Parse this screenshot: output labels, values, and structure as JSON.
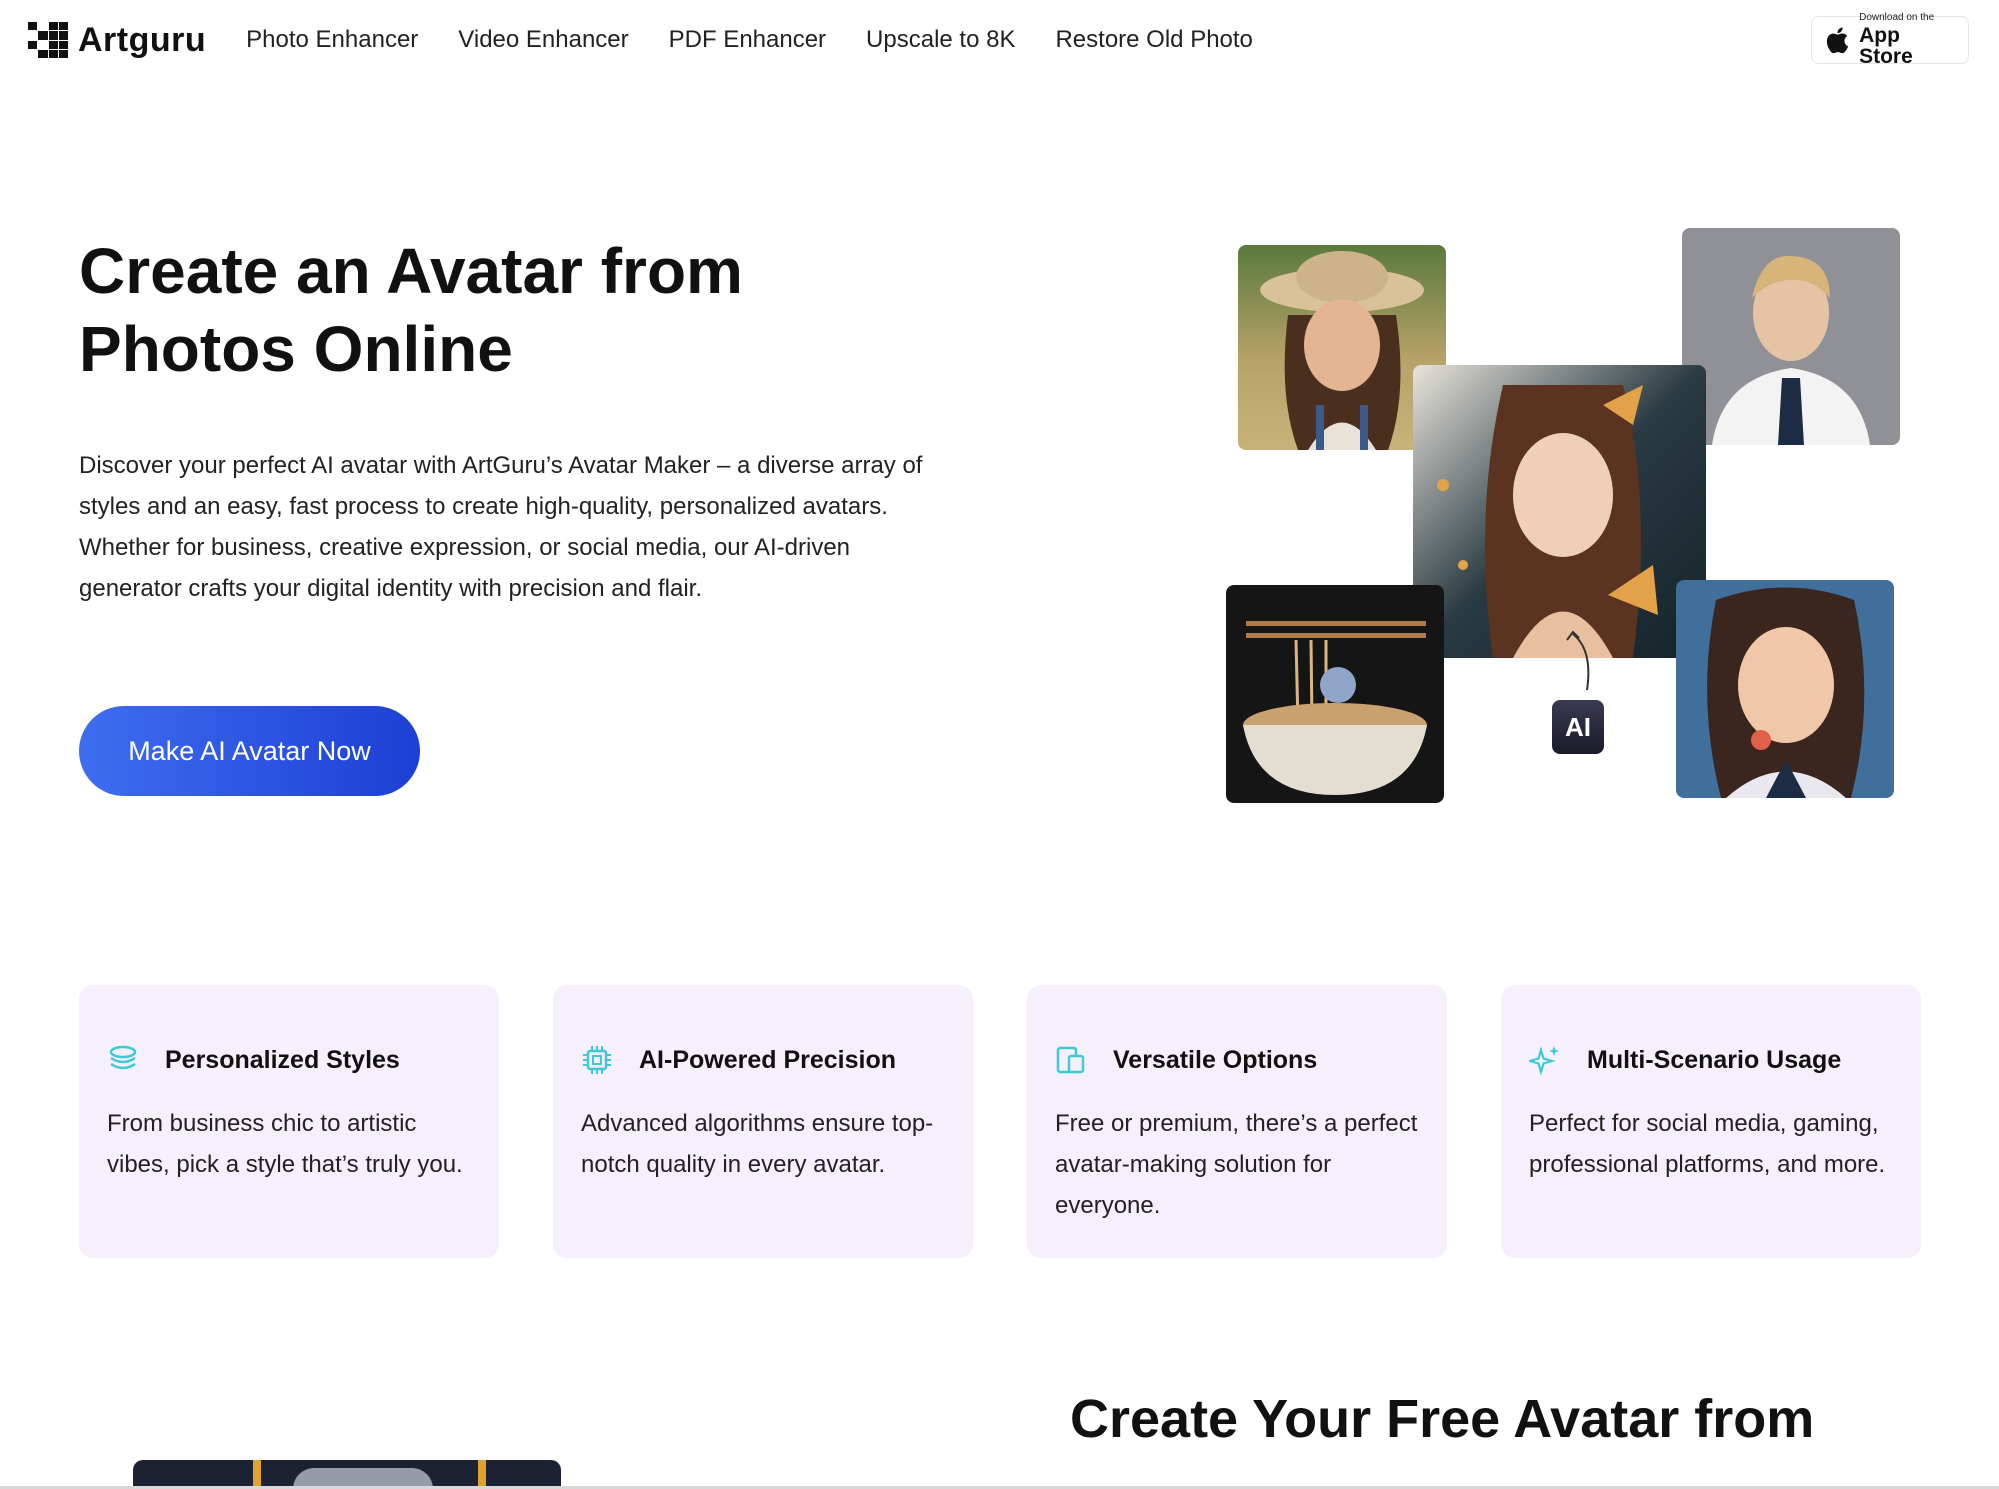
{
  "header": {
    "brand": "Artguru",
    "nav": [
      "Photo Enhancer",
      "Video Enhancer",
      "PDF Enhancer",
      "Upscale to 8K",
      "Restore Old Photo"
    ],
    "appstore": {
      "small": "Download on the",
      "big": "App Store"
    }
  },
  "hero": {
    "title_line1": "Create an Avatar from",
    "title_line2": "Photos Online",
    "description": "Discover your perfect AI avatar with ArtGuru’s Avatar Maker – a diverse array of styles and an easy, fast process to create high-quality, personalized avatars. Whether for business, creative expression, or social media, our AI-driven generator crafts your digital identity with precision and flair.",
    "cta": "Make AI Avatar Now",
    "ai_badge": "AI"
  },
  "features": [
    {
      "title": "Personalized Styles",
      "text": "From business chic to artistic vibes, pick a style that’s truly you.",
      "icon": "layers-icon"
    },
    {
      "title": "AI-Powered Precision",
      "text": "Advanced algorithms ensure top-notch quality in every avatar.",
      "icon": "chip-icon"
    },
    {
      "title": "Versatile Options",
      "text": "Free or premium, there’s a perfect avatar-making solution for everyone.",
      "icon": "devices-icon"
    },
    {
      "title": "Multi-Scenario Usage",
      "text": "Perfect for social media, gaming, professional platforms, and more.",
      "icon": "sparkle-icon"
    }
  ],
  "section2": {
    "title": "Create Your Free Avatar from"
  },
  "colors": {
    "accent": "#2a52e0",
    "card_bg": "#f6effc",
    "icon": "#3ec9d6"
  }
}
